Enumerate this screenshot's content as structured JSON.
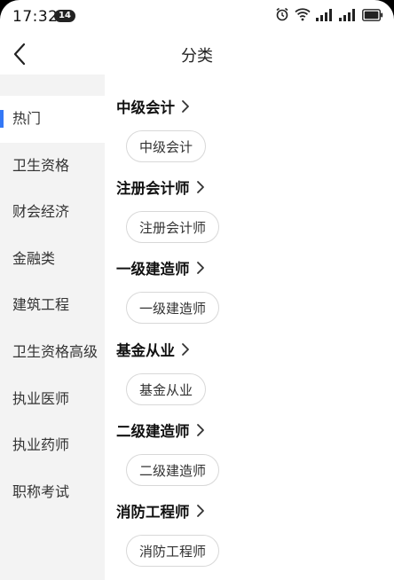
{
  "status_bar": {
    "time": "17:32",
    "notification_count": "14"
  },
  "nav": {
    "title": "分类"
  },
  "sidebar": {
    "items": [
      {
        "label": "热门",
        "active": true
      },
      {
        "label": "卫生资格",
        "active": false
      },
      {
        "label": "财会经济",
        "active": false
      },
      {
        "label": "金融类",
        "active": false
      },
      {
        "label": "建筑工程",
        "active": false
      },
      {
        "label": "卫生资格高级",
        "active": false
      },
      {
        "label": "执业医师",
        "active": false
      },
      {
        "label": "执业药师",
        "active": false
      },
      {
        "label": "职称考试",
        "active": false
      }
    ]
  },
  "content": {
    "categories": [
      {
        "title": "中级会计",
        "chips": [
          "中级会计"
        ]
      },
      {
        "title": "注册会计师",
        "chips": [
          "注册会计师"
        ]
      },
      {
        "title": "一级建造师",
        "chips": [
          "一级建造师"
        ]
      },
      {
        "title": "基金从业",
        "chips": [
          "基金从业"
        ]
      },
      {
        "title": "二级建造师",
        "chips": [
          "二级建造师"
        ]
      },
      {
        "title": "消防工程师",
        "chips": [
          "消防工程师"
        ]
      }
    ]
  },
  "colors": {
    "accent": "#3478f6",
    "sidebar_bg": "#f3f3f3"
  }
}
